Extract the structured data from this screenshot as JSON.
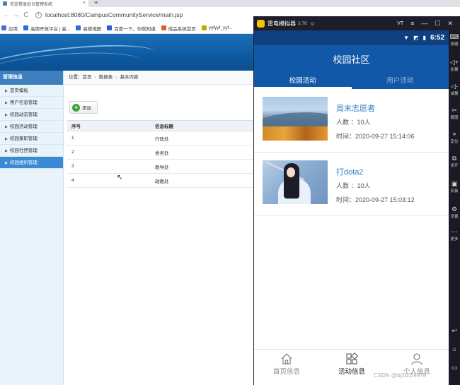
{
  "browser": {
    "tab_title": "欢迎登录后台管理系统",
    "tab_close": "×",
    "new_tab": "+",
    "back": "←",
    "forward": "→",
    "reload": "C",
    "info": "i",
    "url": "localhost:8080/CampusCommunityService/main.jsp",
    "bookmarks": [
      {
        "label": "应用",
        "icon": "apps-grid-icon",
        "color": "#4a6fd1"
      },
      {
        "label": "高德开放平台 | 高...",
        "icon": "amap-icon",
        "color": "#2a6fd6"
      },
      {
        "label": "高德地图",
        "icon": "amap-icon",
        "color": "#2a6fd6"
      },
      {
        "label": "百度一下，你就知道",
        "icon": "baidu-icon",
        "color": "#2f5bd8"
      },
      {
        "label": "成品系统首页",
        "icon": "globe-icon",
        "color": "#e25b2a"
      },
      {
        "label": "yyfyyf_yyf...",
        "icon": "bookmark-icon",
        "color": "#c9a500"
      }
    ]
  },
  "admin": {
    "sidebar": {
      "header": "管理信息",
      "items": [
        {
          "label": "首页模板",
          "active": false
        },
        {
          "label": "用户信息管理",
          "active": false
        },
        {
          "label": "校园动态管理",
          "active": false
        },
        {
          "label": "校园活动管理",
          "active": false
        },
        {
          "label": "校园兼职管理",
          "active": false
        },
        {
          "label": "校园社团管理",
          "active": false
        },
        {
          "label": "校园组织管理",
          "active": true
        }
      ]
    },
    "breadcrumb": {
      "prefix": "位置：",
      "items": [
        "首页",
        "数据表",
        "基本内容"
      ],
      "separator": "›"
    },
    "add_button": "添加",
    "table": {
      "headers": [
        "序号",
        "信息标题"
      ],
      "rows": [
        [
          "1",
          "行政处"
        ],
        [
          "2",
          "党务处"
        ],
        [
          "3",
          "教导处"
        ],
        [
          "4",
          "政教处"
        ]
      ]
    }
  },
  "emulator": {
    "name": "雷电模拟器",
    "version": "3.76",
    "controls": {
      "vt": "VT",
      "menu": "≡",
      "minimize": "—",
      "maximize": "☐",
      "close": "✕"
    },
    "status_time": "6:52",
    "app_title": "校园社区",
    "tabs": [
      {
        "label": "校园活动",
        "active": true
      },
      {
        "label": "用户活动",
        "active": false
      }
    ],
    "activities": [
      {
        "title": "周末志愿者",
        "people": "人数 ：10人",
        "time": "时间：2020-09-27 15:14:06",
        "image": "mountain-landscape"
      },
      {
        "title": "打dota2",
        "people": "人数 ：10人",
        "time": "时间：2020-09-27 15:03:12",
        "image": "anime-swordswoman"
      }
    ],
    "bottom_nav": [
      {
        "label": "首页信息",
        "icon": "home-icon",
        "active": false
      },
      {
        "label": "活动信息",
        "icon": "grid-icon",
        "active": true
      },
      {
        "label": "个人信息",
        "icon": "person-icon",
        "active": false
      }
    ],
    "side_tools": [
      {
        "label": "按键",
        "icon": "keyboard-icon",
        "glyph": "⌨"
      },
      {
        "label": "加量",
        "icon": "volume-up-icon",
        "glyph": "◁+"
      },
      {
        "label": "减量",
        "icon": "volume-down-icon",
        "glyph": "◁-"
      },
      {
        "label": "截图",
        "icon": "scissors-icon",
        "glyph": "✂"
      },
      {
        "label": "定位",
        "icon": "location-icon",
        "glyph": "⌖"
      },
      {
        "label": "多开",
        "icon": "multi-window-icon",
        "glyph": "⧉"
      },
      {
        "label": "安装",
        "icon": "install-icon",
        "glyph": "▣"
      },
      {
        "label": "设置",
        "icon": "gear-icon",
        "glyph": "⚙"
      },
      {
        "label": "更多",
        "icon": "more-icon",
        "glyph": "⋯"
      },
      {
        "label": "",
        "icon": "back-icon",
        "glyph": "↩"
      },
      {
        "label": "",
        "icon": "home-icon",
        "glyph": "⌂"
      },
      {
        "label": "",
        "icon": "recent-apps-icon",
        "glyph": "▭"
      }
    ]
  },
  "watermark": "CSDN @bj2l22l9979"
}
